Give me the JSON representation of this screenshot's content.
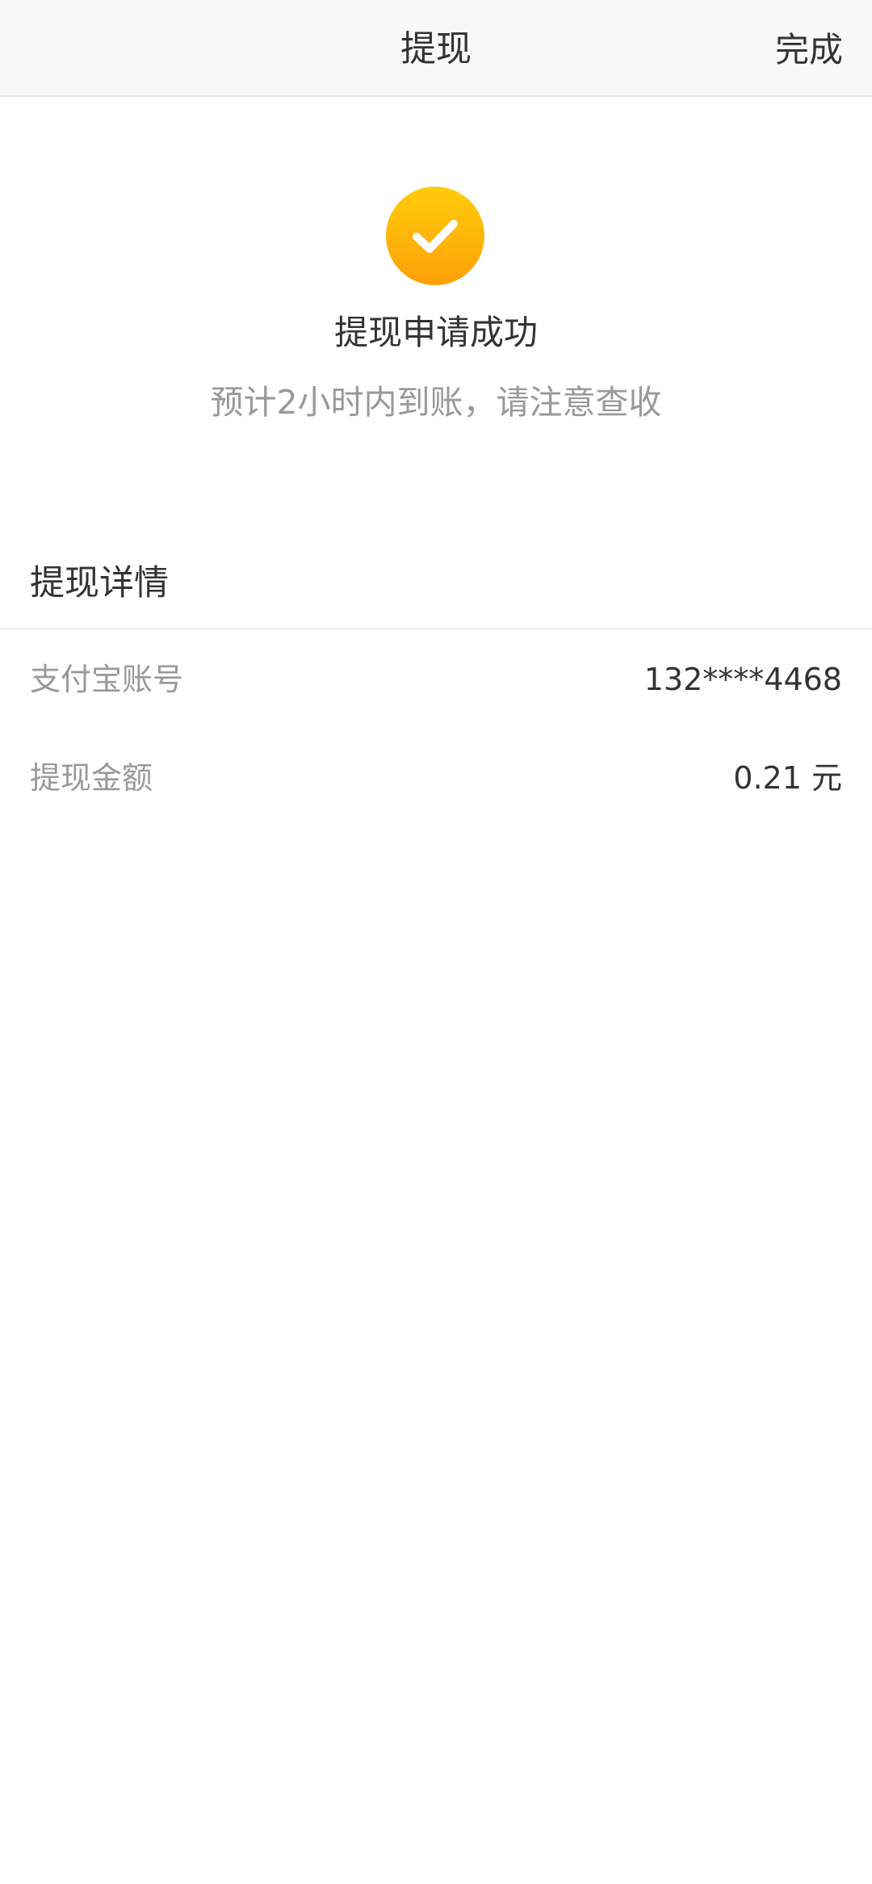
{
  "header": {
    "title": "提现",
    "done_label": "完成"
  },
  "result": {
    "icon": "check-circle-icon",
    "accent_color": "#FFB300",
    "title": "提现申请成功",
    "subtitle": "预计2小时内到账，请注意查收"
  },
  "details": {
    "section_title": "提现详情",
    "rows": [
      {
        "label": "支付宝账号",
        "value": "132****4468"
      },
      {
        "label": "提现金额",
        "value": "0.21 元"
      }
    ]
  }
}
